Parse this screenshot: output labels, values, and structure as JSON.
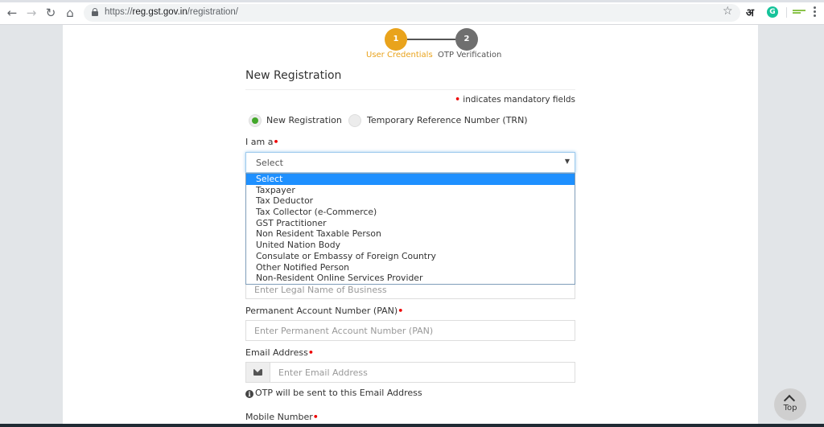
{
  "browser": {
    "url_scheme": "https://",
    "url_host": "reg.gst.gov.in",
    "url_path": "/registration/",
    "ext_hindi": "अ",
    "ext_grammarly": "G"
  },
  "stepper": {
    "steps": [
      {
        "number": "1",
        "label": "User Credentials",
        "status": "active",
        "color": "#e9a31c"
      },
      {
        "number": "2",
        "label": "OTP Verification",
        "status": "pending",
        "color": "#6f6f6f"
      }
    ]
  },
  "form": {
    "title": "New Registration",
    "mandatory_note": "indicates mandatory fields",
    "required_marker": "•",
    "radio_options": [
      {
        "label": "New Registration",
        "checked": true
      },
      {
        "label": "Temporary Reference Number (TRN)",
        "checked": false
      }
    ],
    "i_am_a": {
      "label": "I am a",
      "selected": "Select",
      "options": [
        "Select",
        "Taxpayer",
        "Tax Deductor",
        "Tax Collector (e-Commerce)",
        "GST Practitioner",
        "Non Resident Taxable Person",
        "United Nation Body",
        "Consulate or Embassy of Foreign Country",
        "Other Notified Person",
        "Non-Resident Online Services Provider"
      ]
    },
    "legal_name": {
      "placeholder": "Enter Legal Name of Business"
    },
    "pan": {
      "label": "Permanent Account Number (PAN)",
      "placeholder": "Enter Permanent Account Number (PAN)"
    },
    "email": {
      "label": "Email Address",
      "placeholder": "Enter Email Address",
      "info": "OTP will be sent to this Email Address"
    },
    "mobile": {
      "label": "Mobile Number"
    }
  },
  "top_button": {
    "label": "Top"
  },
  "colors": {
    "accent": "#e9a31c",
    "selected_option": "#1e90ff",
    "radio_checked": "#43a72a",
    "required": "#ee0000"
  }
}
